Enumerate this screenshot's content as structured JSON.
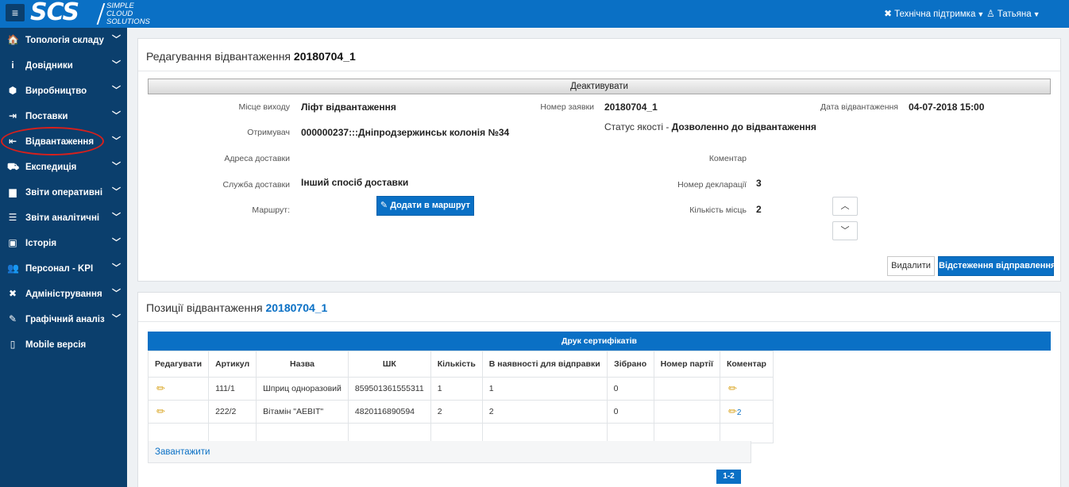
{
  "header": {
    "logo": "SCS",
    "logo_sub": [
      "SIMPLE",
      "CLOUD",
      "SOLUTIONS"
    ],
    "support_label": "Технічна підтримка",
    "user_label": "Татьяна"
  },
  "sidebar": {
    "items": [
      {
        "label": "Топологія складу",
        "icon": "warehouse-icon",
        "glyph": "🏠"
      },
      {
        "label": "Довідники",
        "icon": "info-icon",
        "glyph": "i"
      },
      {
        "label": "Виробництво",
        "icon": "cube-icon",
        "glyph": "⬢"
      },
      {
        "label": "Поставки",
        "icon": "sign-in-icon",
        "glyph": "⇥"
      },
      {
        "label": "Відвантаження",
        "icon": "sign-out-icon",
        "glyph": "⇤"
      },
      {
        "label": "Експедиція",
        "icon": "truck-icon",
        "glyph": "⛟"
      },
      {
        "label": "Звіти оперативні",
        "icon": "bar-chart-icon",
        "glyph": "▆"
      },
      {
        "label": "Звіти аналітичні",
        "icon": "list-icon",
        "glyph": "☰"
      },
      {
        "label": "Історія",
        "icon": "calendar-icon",
        "glyph": "▣"
      },
      {
        "label": "Персонал - KPI",
        "icon": "users-icon",
        "glyph": "👥"
      },
      {
        "label": "Адміністрування",
        "icon": "tools-icon",
        "glyph": "✖"
      },
      {
        "label": "Графічний аналіз",
        "icon": "edit-chart-icon",
        "glyph": "✎"
      },
      {
        "label": "Mobile версія",
        "icon": "mobile-icon",
        "glyph": "▯"
      }
    ]
  },
  "shipment": {
    "title_prefix": "Редагування відвантаження",
    "title_number": "20180704_1",
    "deactivate_label": "Деактивувати",
    "fields": {
      "exit_place_label": "Місце виходу",
      "exit_place": "Ліфт відвантаження",
      "order_no_label": "Номер заявки",
      "order_no": "20180704_1",
      "ship_date_label": "Дата відвантаження",
      "ship_date": "04-07-2018 15:00",
      "recipient_label": "Отримувач",
      "recipient": "000000237:::Дніпродзержинськ колонія №34",
      "quality_label": "Статус якості - ",
      "quality": "Дозволенно до відвантаження",
      "address_label": "Адреса доставки",
      "comment_label": "Коментар",
      "delivery_label": "Служба доставки",
      "delivery": "Інший спосіб доставки",
      "declaration_label": "Номер декларації",
      "declaration": "3",
      "route_label": "Маршрут:",
      "add_route_label": "Додати в маршрут",
      "places_label": "Кількість місць",
      "places": "2"
    },
    "delete_label": "Видалити",
    "track_label": "Відстеження відправлення"
  },
  "positions": {
    "title_prefix": "Позиції відвантаження",
    "title_number": "20180704_1",
    "print_label": "Друк сертифікатів",
    "columns": [
      "Редагувати",
      "Артикул",
      "Назва",
      "ШК",
      "Кількість",
      "В наявності для відправки",
      "Зібрано",
      "Номер партії",
      "Коментар"
    ],
    "rows": [
      {
        "article": "111/1",
        "name": "Шприц одноразовий",
        "barcode": "859501361555311",
        "qty": "1",
        "available": "1",
        "collected": "0",
        "batch": "",
        "comment_count": ""
      },
      {
        "article": "222/2",
        "name": "Вітамін \"АЕВІТ\"",
        "barcode": "4820116890594",
        "qty": "2",
        "available": "2",
        "collected": "0",
        "batch": "",
        "comment_count": "2"
      }
    ],
    "load_label": "Завантажити",
    "pager_label": "1-2"
  }
}
